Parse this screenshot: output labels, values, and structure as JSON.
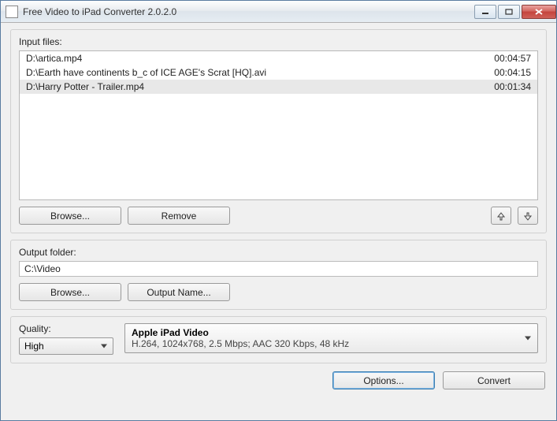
{
  "window": {
    "title": "Free Video to iPad Converter 2.0.2.0"
  },
  "input": {
    "label": "Input files:",
    "files": [
      {
        "name": "D:\\artica.mp4",
        "duration": "00:04:57"
      },
      {
        "name": "D:\\Earth have continents b_c of ICE AGE's Scrat [HQ].avi",
        "duration": "00:04:15"
      },
      {
        "name": "D:\\Harry Potter - Trailer.mp4",
        "duration": "00:01:34"
      }
    ],
    "browse": "Browse...",
    "remove": "Remove"
  },
  "output": {
    "label": "Output folder:",
    "path": "C:\\Video",
    "browse": "Browse...",
    "outputName": "Output Name..."
  },
  "quality": {
    "label": "Quality:",
    "value": "High",
    "preset_title": "Apple iPad Video",
    "preset_sub": "H.264, 1024x768, 2.5 Mbps; AAC 320 Kbps, 48 kHz"
  },
  "actions": {
    "options": "Options...",
    "convert": "Convert"
  }
}
